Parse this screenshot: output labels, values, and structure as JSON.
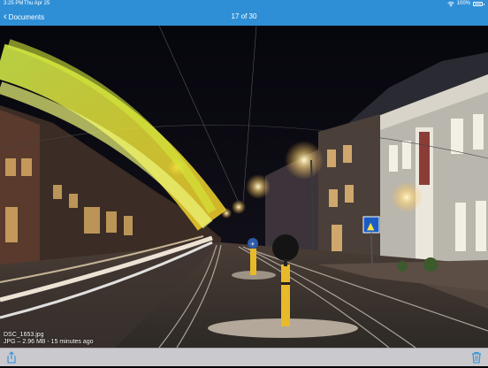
{
  "status_bar": {
    "time": "3:25 PM",
    "date": "Thu Apr 25",
    "battery": "100%",
    "icons": [
      "wifi-icon",
      "battery-icon"
    ]
  },
  "nav": {
    "back_label": "Documents",
    "back_icon": "chevron-left-icon",
    "title": "17 of 30"
  },
  "photo": {
    "filename": "DSC_1653.jpg",
    "details": "JPG – 2.96 MB - 15 minutes ago",
    "signs": {
      "bike": "✈",
      "crossing": "▲"
    }
  },
  "toolbar": {
    "share_icon": "share-icon",
    "trash_icon": "trash-icon"
  },
  "colors": {
    "accent": "#2f8fd6",
    "toolbar_bg": "#c9c9ce",
    "icon_tint": "#2f8fd6"
  }
}
